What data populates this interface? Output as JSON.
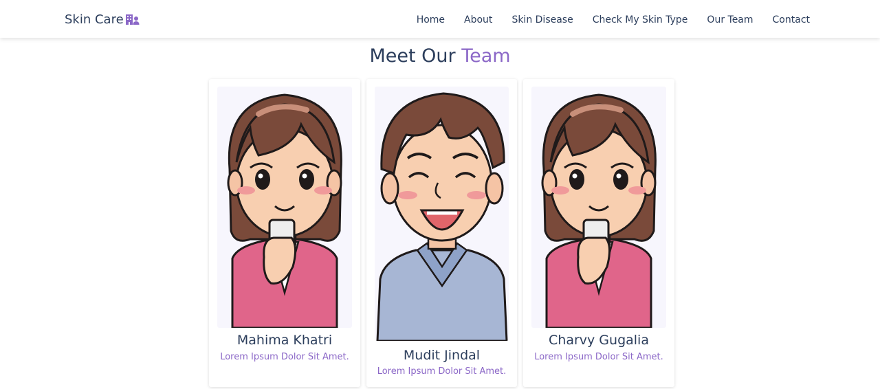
{
  "navbar": {
    "brand": "Skin Care",
    "brand_icon": "hospital-user-icon",
    "links": [
      "Home",
      "About",
      "Skin Disease",
      "Check My Skin Type",
      "Our Team",
      "Contact"
    ]
  },
  "section": {
    "title_part1": "Meet Our",
    "title_part2": "Team"
  },
  "team": [
    {
      "name": "Mahima Khatri",
      "role": "Lorem Ipsum Dolor Sit Amet.",
      "avatar": "woman-with-phone-avatar"
    },
    {
      "name": "Mudit Jindal",
      "role": "Lorem Ipsum Dolor Sit Amet.",
      "avatar": "smiling-man-avatar"
    },
    {
      "name": "Charvy Gugalia",
      "role": "Lorem Ipsum Dolor Sit Amet.",
      "avatar": "woman-with-phone-avatar"
    }
  ],
  "colors": {
    "text": "#2c3e5c",
    "accent": "#8b67c7",
    "image_bg": "#f7f6fd"
  }
}
